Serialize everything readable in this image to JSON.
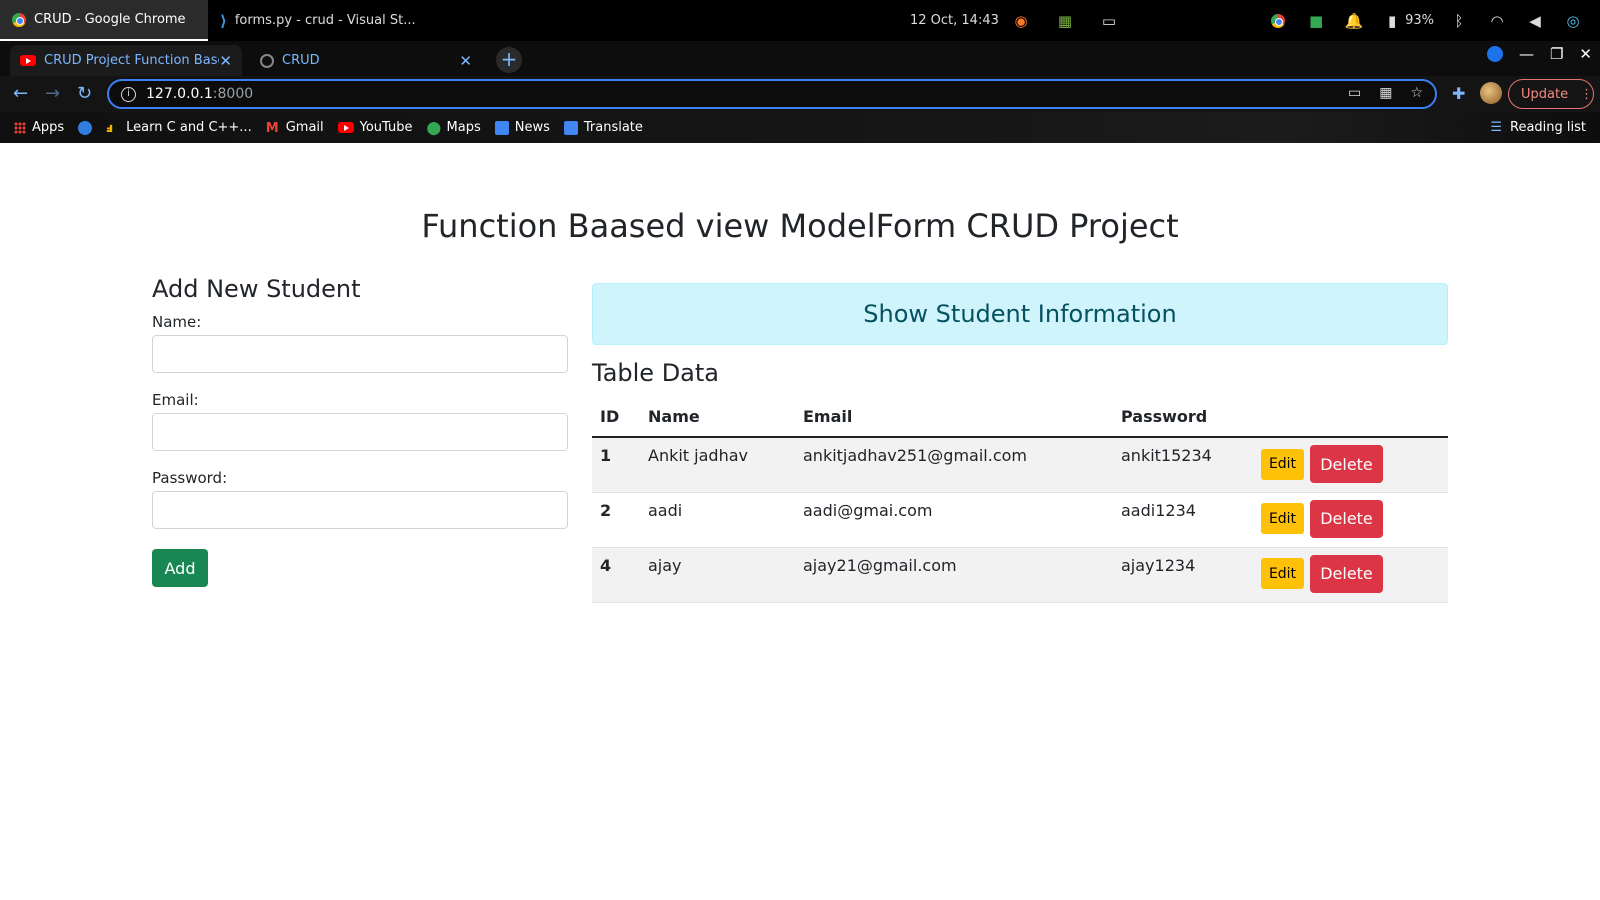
{
  "taskbar": {
    "active_task": "CRUD - Google Chrome",
    "second_task": "forms.py - crud - Visual St...",
    "clock": "12 Oct, 14:43",
    "battery": "93%"
  },
  "tabs": [
    {
      "title": "CRUD Project Function Based",
      "close": "✕"
    },
    {
      "title": "CRUD",
      "close": "✕"
    }
  ],
  "newtab_label": "+",
  "address": {
    "host": "127.0.0.1",
    "port": ":8000"
  },
  "update_label": "Update",
  "bookmarks": {
    "apps": "Apps",
    "learn": "Learn C and C++...",
    "gmail": "Gmail",
    "youtube": "YouTube",
    "maps": "Maps",
    "news": "News",
    "translate": "Translate",
    "reading_list": "Reading list"
  },
  "page": {
    "title": "Function Baased view ModelForm CRUD Project",
    "form": {
      "heading": "Add New Student",
      "name_label": "Name:",
      "email_label": "Email:",
      "password_label": "Password:",
      "name_value": "",
      "email_value": "",
      "password_value": "",
      "add_label": "Add"
    },
    "alert": "Show Student Information",
    "table_title": "Table Data",
    "columns": [
      "ID",
      "Name",
      "Email",
      "Password"
    ],
    "rows": [
      {
        "id": "1",
        "name": "Ankit jadhav",
        "email": "ankitjadhav251@gmail.com",
        "password": "ankit15234"
      },
      {
        "id": "2",
        "name": "aadi",
        "email": "aadi@gmai.com",
        "password": "aadi1234"
      },
      {
        "id": "4",
        "name": "ajay",
        "email": "ajay21@gmail.com",
        "password": "ajay1234"
      }
    ],
    "edit_label": "Edit",
    "delete_label": "Delete"
  },
  "colors": {
    "add_button": "#198754",
    "edit_button": "#ffc107",
    "delete_button": "#dc3545",
    "alert_bg": "#cff4fc",
    "alert_text": "#055160"
  }
}
